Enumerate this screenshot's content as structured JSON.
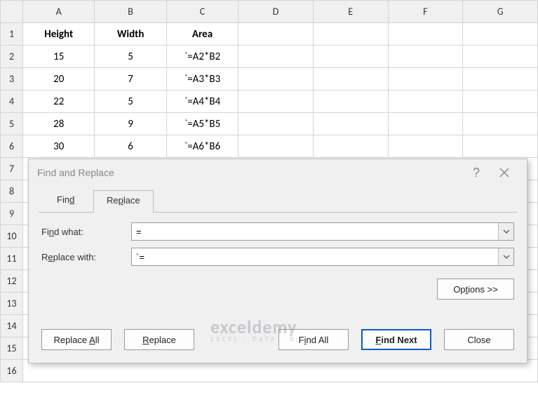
{
  "columns": [
    "A",
    "B",
    "C",
    "D",
    "E",
    "F",
    "G"
  ],
  "row_numbers": [
    "1",
    "2",
    "3",
    "4",
    "5",
    "6",
    "7",
    "8",
    "9",
    "10",
    "11",
    "12",
    "13",
    "14",
    "15",
    "16"
  ],
  "grid": {
    "headers": {
      "A": "Height",
      "B": "Width",
      "C": "Area"
    },
    "rows": [
      {
        "A": "15",
        "B": "5",
        "C": "`=A2*B2"
      },
      {
        "A": "20",
        "B": "7",
        "C": "`=A3*B3"
      },
      {
        "A": "22",
        "B": "5",
        "C": "`=A4*B4"
      },
      {
        "A": "28",
        "B": "9",
        "C": "`=A5*B5"
      },
      {
        "A": "30",
        "B": "6",
        "C": "`=A6*B6"
      }
    ]
  },
  "dialog": {
    "title": "Find and Replace",
    "help": "?",
    "tabs": {
      "find": "Find",
      "replace": "Replace"
    },
    "find_label": "Find what:",
    "find_value": "=",
    "replace_label": "Replace with:",
    "replace_value": "`=",
    "options": "Options >>",
    "buttons": {
      "replace_all": "Replace All",
      "replace": "Replace",
      "find_all": "Find All",
      "find_next": "Find Next",
      "close": "Close"
    }
  },
  "watermark": {
    "main": "exceldemy",
    "sub": "EXCEL · DATA · BI"
  }
}
